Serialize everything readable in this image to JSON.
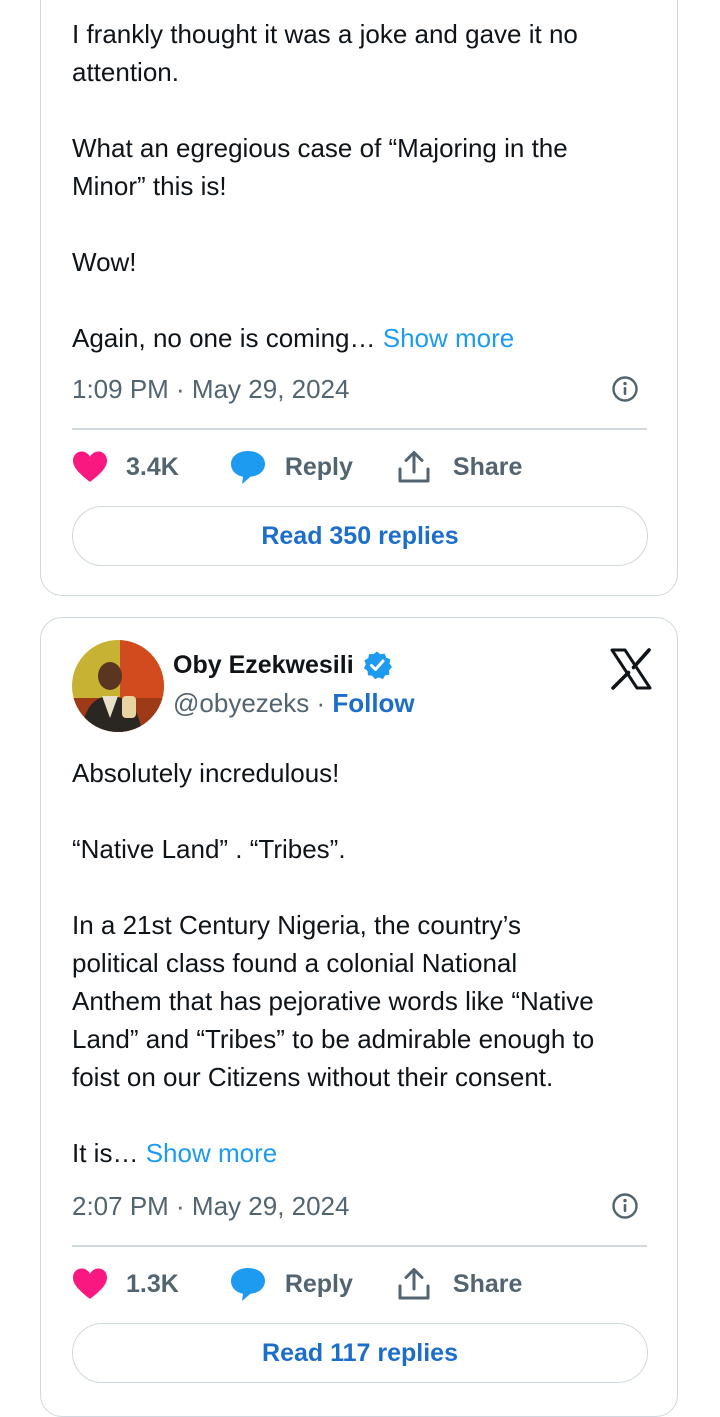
{
  "tweet1": {
    "paragraphs": [
      "I frankly thought it was a joke and gave it no\nattention.",
      "What an egregious case of “Majoring in the\nMinor” this is!",
      "Wow!"
    ],
    "last_line": "Again, no one is coming…",
    "show_more": "Show more",
    "timestamp": "1:09 PM · May 29, 2024",
    "likes": "3.4K",
    "reply_label": "Reply",
    "share_label": "Share",
    "read_replies": "Read 350 replies"
  },
  "tweet2": {
    "author_name": "Oby Ezekwesili",
    "handle": "@obyezeks",
    "separator": " · ",
    "follow_label": "Follow",
    "paragraphs": [
      "Absolutely incredulous!",
      "“Native Land” . “Tribes”.",
      "In a 21st Century Nigeria, the country’s\npolitical class found a colonial National\nAnthem that has pejorative words like “Native\nLand” and “Tribes” to be admirable enough to\nfoist on our Citizens without their consent."
    ],
    "last_line": "It is…",
    "show_more": "Show more",
    "timestamp": "2:07 PM · May 29, 2024",
    "likes": "1.3K",
    "reply_label": "Reply",
    "share_label": "Share",
    "read_replies": "Read 117 replies"
  },
  "colors": {
    "like": "#f91880",
    "reply": "#1d9bf0",
    "link": "#1d9bf0",
    "button_text": "#1d6ec9",
    "verified": "#1d9bf0",
    "muted": "#536471",
    "border": "#cfd9de"
  },
  "icons": [
    "heart-icon",
    "speech-bubble-icon",
    "share-icon",
    "info-icon",
    "verified-badge-icon",
    "x-logo-icon"
  ]
}
